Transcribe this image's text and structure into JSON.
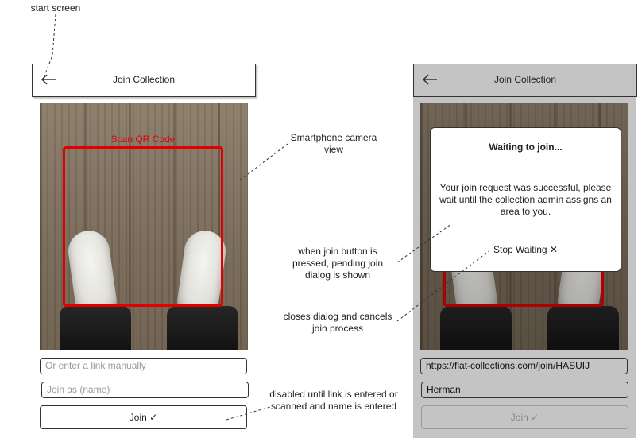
{
  "annotations": {
    "start_screen": "start screen",
    "camera_view": "Smartphone camera view",
    "join_pressed": "when join button is pressed, pending join dialog is shown",
    "closes_dialog": "closes dialog and cancels join process",
    "disabled_note": "disabled until link is entered or scanned and name is entered"
  },
  "left_screen": {
    "header_title": "Join Collection",
    "back_icon": "arrow-left-icon",
    "qr_label": "Scan QR Code",
    "link_placeholder": "Or enter a link manually",
    "name_placeholder": "Join as (name)",
    "join_button": "Join ✓"
  },
  "right_screen": {
    "header_title": "Join Collection",
    "back_icon": "arrow-left-icon",
    "dialog": {
      "title": "Waiting to join...",
      "body": "Your join request was successful, please wait until the collection admin assigns an area to you.",
      "stop_button": "Stop Waiting ✕"
    },
    "link_value": "https://flat-collections.com/join/HASUIJ",
    "name_value": "Herman",
    "join_button": "Join ✓"
  },
  "colors": {
    "qr_frame": "#e00000",
    "dim_overlay": "#c4c4c4"
  }
}
